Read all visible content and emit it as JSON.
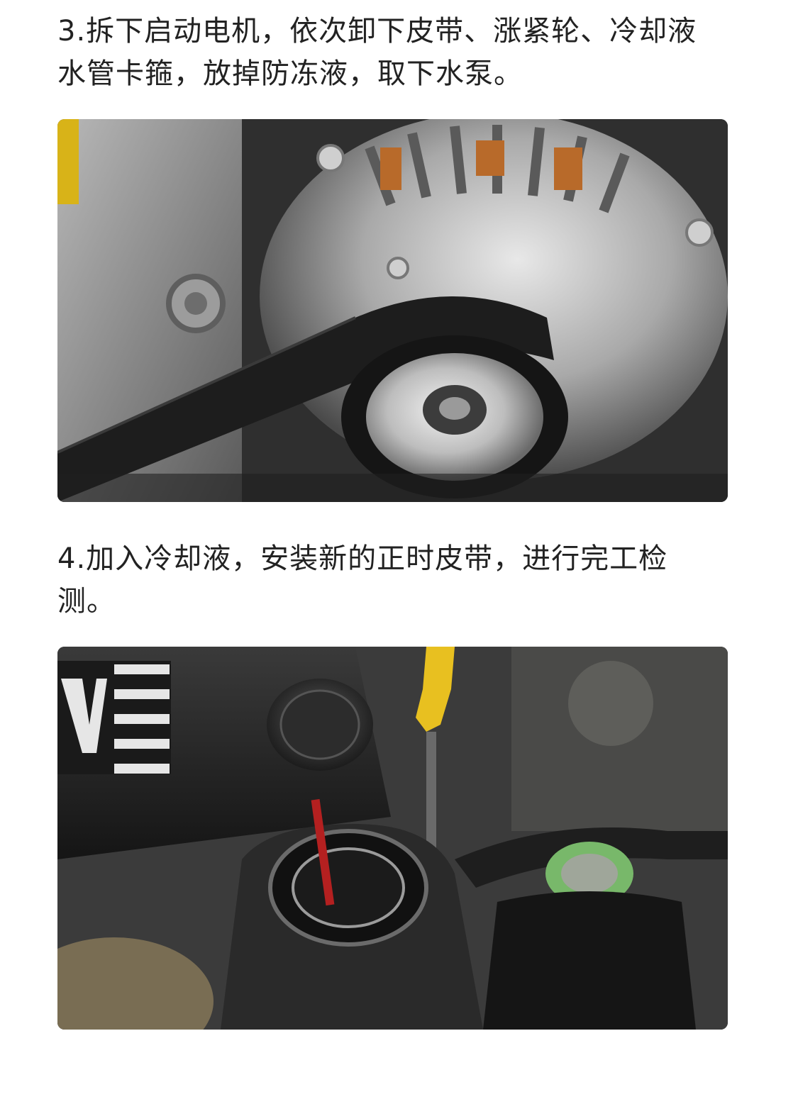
{
  "steps": [
    {
      "text": "3.拆下启动电机，依次卸下皮带、涨紧轮、冷却液\n水管卡箍，放掉防冻液，取下水泵。"
    },
    {
      "text": "4.加入冷却液，安装新的正时皮带，进行完工检\n测。"
    }
  ],
  "colors": {
    "text": "#222222",
    "background": "#ffffff"
  }
}
